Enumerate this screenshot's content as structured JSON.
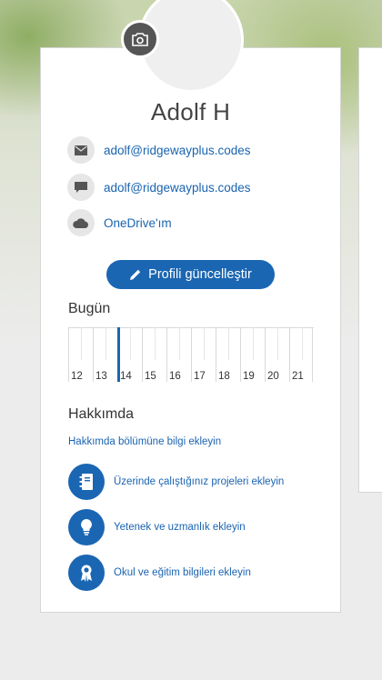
{
  "profile": {
    "name": "Adolf H",
    "camera_icon": "camera-icon"
  },
  "contacts": [
    {
      "icon": "mail-icon",
      "text": "adolf@ridgewayplus.codes"
    },
    {
      "icon": "chat-icon",
      "text": "adolf@ridgewayplus.codes"
    },
    {
      "icon": "cloud-icon",
      "text": "OneDrive'ım"
    }
  ],
  "actions": {
    "update_profile_label": "Profili güncelleştir",
    "update_profile_icon": "pencil-icon"
  },
  "today": {
    "title": "Bugün",
    "hours": [
      "12",
      "13",
      "14",
      "15",
      "16",
      "17",
      "18",
      "19",
      "20",
      "21"
    ],
    "current_hour_fraction": 0.6
  },
  "about": {
    "title": "Hakkımda",
    "add_link": "Hakkımda bölümüne bilgi ekleyin",
    "items": [
      {
        "icon": "notebook-icon",
        "text": "Üzerinde çalıştığınız projeleri ekleyin"
      },
      {
        "icon": "lightbulb-icon",
        "text": "Yetenek ve uzmanlık ekleyin"
      },
      {
        "icon": "ribbon-icon",
        "text": "Okul ve eğitim bilgileri ekleyin"
      }
    ]
  },
  "colors": {
    "accent": "#1a66b3",
    "link": "#1a63b0"
  }
}
